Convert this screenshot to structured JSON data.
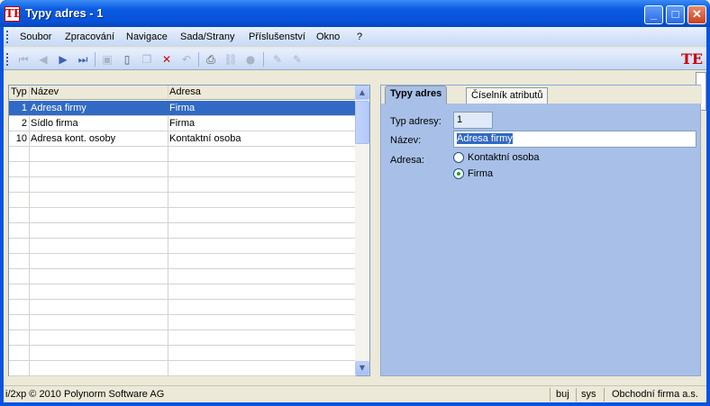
{
  "window": {
    "title": "Typy adres - 1",
    "app_icon": "TE",
    "minimize": "_",
    "maximize": "□",
    "close": "✕"
  },
  "menu": [
    "Soubor",
    "Zpracování",
    "Navigace",
    "Sada/Strany",
    "Příslušenství",
    "Okno",
    "?"
  ],
  "toolbar": {
    "icons": [
      "first-record-icon",
      "previous-record-icon",
      "next-record-icon",
      "last-record-icon",
      "save-icon",
      "new-icon",
      "copy-icon",
      "delete-icon",
      "undo-icon",
      "print-icon",
      "link-icon",
      "info-icon",
      "edit-icon",
      "edit2-icon"
    ],
    "logo": "TE"
  },
  "grid": {
    "columns": [
      "Typ",
      "Název",
      "Adresa"
    ],
    "rows": [
      {
        "typ": "1",
        "nazev": "Adresa firmy",
        "adresa": "Firma",
        "selected": true
      },
      {
        "typ": "2",
        "nazev": "Sídlo firma",
        "adresa": "Firma",
        "selected": false
      },
      {
        "typ": "10",
        "nazev": "Adresa kont. osoby",
        "adresa": "Kontaktní osoba",
        "selected": false
      }
    ]
  },
  "tabs": [
    "Typy adres",
    "Číselník atributů"
  ],
  "form": {
    "typ_label": "Typ adresy:",
    "typ_value": "1",
    "nazev_label": "Název:",
    "nazev_value": "Adresa firmy",
    "adresa_label": "Adresa:",
    "options": [
      {
        "label": "Kontaktní osoba",
        "checked": false
      },
      {
        "label": "Firma",
        "checked": true
      }
    ]
  },
  "status": {
    "copyright": "i/2xp © 2010 Polynorm Software AG",
    "user": "buj",
    "db": "sys",
    "company": "Obchodní firma a.s."
  },
  "colors": {
    "selection": "#316ac5",
    "panel": "#a8c0e8",
    "titlebar": "#0a5ae3"
  }
}
